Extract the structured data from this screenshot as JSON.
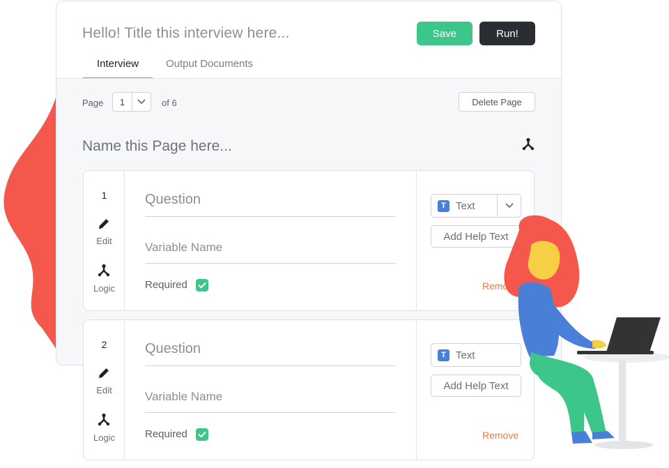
{
  "header": {
    "title_placeholder": "Hello! Title this interview here...",
    "save_label": "Save",
    "run_label": "Run!",
    "tabs": [
      {
        "label": "Interview",
        "active": true
      },
      {
        "label": "Output Documents",
        "active": false
      }
    ]
  },
  "page_bar": {
    "page_label": "Page",
    "page_value": "1",
    "of_label": "of 6",
    "delete_label": "Delete Page",
    "page_name_placeholder": "Name this Page here..."
  },
  "questions": [
    {
      "number": "1",
      "edit_label": "Edit",
      "logic_label": "Logic",
      "question_placeholder": "Question",
      "variable_placeholder": "Variable Name",
      "required_label": "Required",
      "required": true,
      "type_badge": "T",
      "type_label": "Text",
      "help_label": "Add Help Text",
      "remove_label": "Remove"
    },
    {
      "number": "2",
      "edit_label": "Edit",
      "logic_label": "Logic",
      "question_placeholder": "Question",
      "variable_placeholder": "Variable Name",
      "required_label": "Required",
      "required": true,
      "type_badge": "T",
      "type_label": "Text",
      "help_label": "Add Help Text",
      "remove_label": "Remove"
    }
  ],
  "colors": {
    "accent_green": "#3cc68a",
    "dark_button": "#2a2d31",
    "remove_orange": "#f07a45",
    "blob_red": "#f4574b",
    "type_badge_blue": "#4a7fd8"
  },
  "icons": [
    "logic-icon",
    "edit-pencil-icon",
    "chevron-down-icon",
    "checkmark-icon"
  ]
}
